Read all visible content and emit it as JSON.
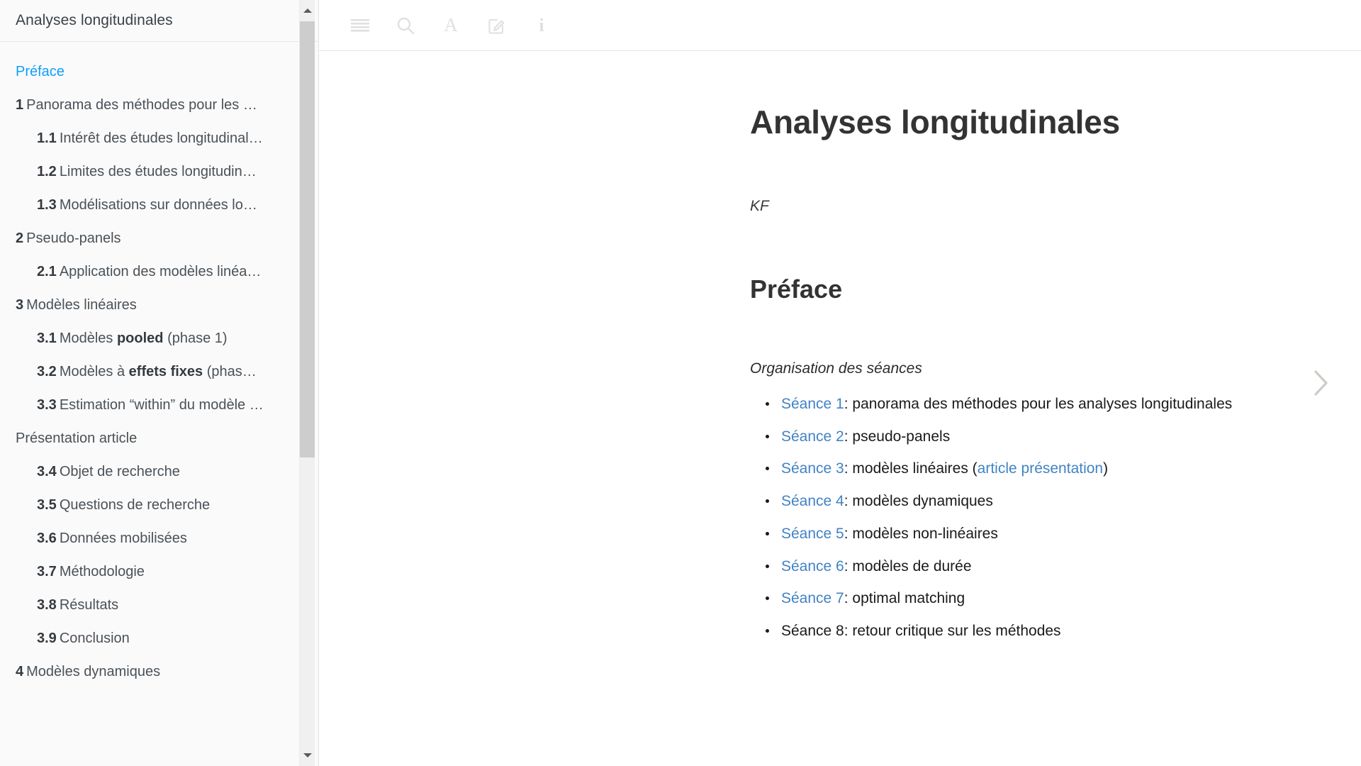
{
  "sidebar": {
    "title": "Analyses longitudinales",
    "scrollbar": {
      "up_arrow_icon": "chevron-up-icon",
      "down_arrow_icon": "chevron-down-icon"
    },
    "items": [
      {
        "num": "",
        "label": "Préface",
        "level": 1,
        "active": true
      },
      {
        "num": "1",
        "label": "Panorama des méthodes pour les …",
        "level": 1,
        "active": false
      },
      {
        "num": "1.1",
        "label": "Intérêt des études longitudinal…",
        "level": 2,
        "active": false
      },
      {
        "num": "1.2",
        "label": "Limites des études longitudin…",
        "level": 2,
        "active": false
      },
      {
        "num": "1.3",
        "label": "Modélisations sur données lo…",
        "level": 2,
        "active": false
      },
      {
        "num": "2",
        "label": "Pseudo-panels",
        "level": 1,
        "active": false
      },
      {
        "num": "2.1",
        "label": "Application des modèles linéa…",
        "level": 2,
        "active": false
      },
      {
        "num": "3",
        "label": "Modèles linéaires",
        "level": 1,
        "active": false
      },
      {
        "num": "3.1",
        "label": "Modèles pooled (phase 1)",
        "level": 2,
        "active": false,
        "bold_part": "pooled"
      },
      {
        "num": "3.2",
        "label": "Modèles à effets fixes (phas…",
        "level": 2,
        "active": false,
        "bold_part": "effets fixes"
      },
      {
        "num": "3.3",
        "label": "Estimation “within” du modèle …",
        "level": 2,
        "active": false
      },
      {
        "num": "",
        "label": "Présentation article",
        "level": 1,
        "active": false
      },
      {
        "num": "3.4",
        "label": "Objet de recherche",
        "level": 2,
        "active": false
      },
      {
        "num": "3.5",
        "label": "Questions de recherche",
        "level": 2,
        "active": false
      },
      {
        "num": "3.6",
        "label": "Données mobilisées",
        "level": 2,
        "active": false
      },
      {
        "num": "3.7",
        "label": "Méthodologie",
        "level": 2,
        "active": false
      },
      {
        "num": "3.8",
        "label": "Résultats",
        "level": 2,
        "active": false
      },
      {
        "num": "3.9",
        "label": "Conclusion",
        "level": 2,
        "active": false
      },
      {
        "num": "4",
        "label": "Modèles dynamiques",
        "level": 1,
        "active": false
      }
    ]
  },
  "toolbar": {
    "buttons": [
      {
        "icon": "hamburger-menu-icon",
        "name": "toggle-sidebar-button"
      },
      {
        "icon": "search-icon",
        "name": "search-button"
      },
      {
        "icon": "font-size-icon",
        "name": "font-settings-button",
        "glyph": "A"
      },
      {
        "icon": "edit-icon",
        "name": "edit-button"
      },
      {
        "icon": "info-icon",
        "name": "info-button",
        "glyph": "i"
      }
    ]
  },
  "content": {
    "book_title": "Analyses longitudinales",
    "author": "KF",
    "preface_heading": "Préface",
    "section_intro": "Organisation des séances",
    "seances": [
      {
        "link": "Séance 1",
        "is_link": true,
        "text": ": panorama des méthodes pour les analyses longitudinales"
      },
      {
        "link": "Séance 2",
        "is_link": true,
        "text": ": pseudo-panels"
      },
      {
        "link": "Séance 3",
        "is_link": true,
        "text": ": modèles linéaires (",
        "extra_link": "article présentation",
        "text_after": ")"
      },
      {
        "link": "Séance 4",
        "is_link": true,
        "text": ": modèles dynamiques"
      },
      {
        "link": "Séance 5",
        "is_link": true,
        "text": ": modèles non-linéaires"
      },
      {
        "link": "Séance 6",
        "is_link": true,
        "text": ": modèles de durée"
      },
      {
        "link": "Séance 7",
        "is_link": true,
        "text": ": optimal matching"
      },
      {
        "link": "Séance 8",
        "is_link": false,
        "text": ": retour critique sur les méthodes"
      }
    ]
  },
  "navigation": {
    "next_icon": "chevron-right-icon"
  },
  "colors": {
    "link": "#4183c4",
    "active_toc": "#0d9ffa",
    "sidebar_bg": "#fafafa",
    "text": "#333333",
    "toolbar_icon": "#e0e0e0"
  }
}
